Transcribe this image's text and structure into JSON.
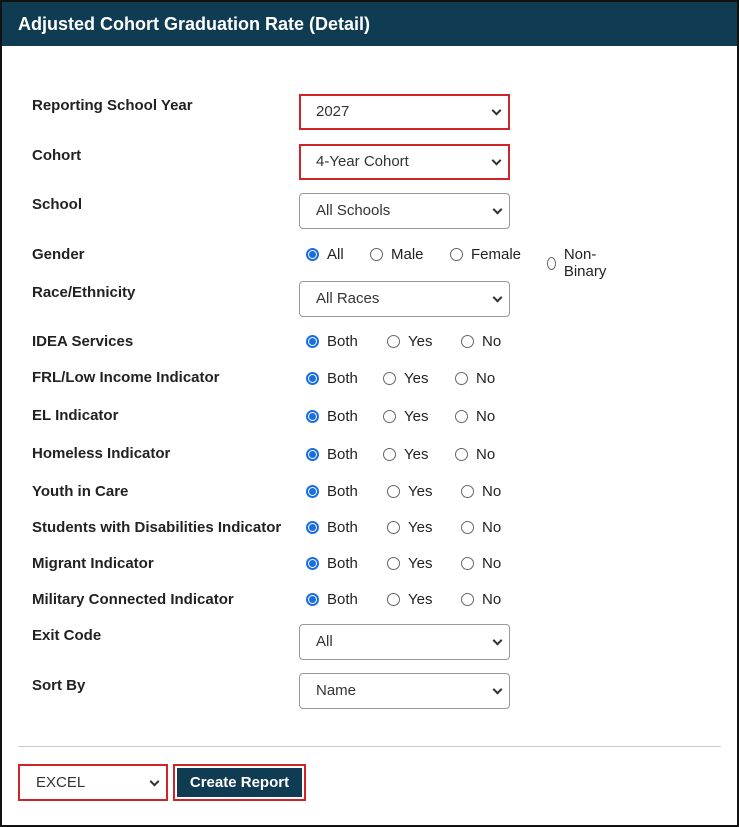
{
  "header": {
    "title": "Adjusted Cohort Graduation Rate (Detail)"
  },
  "fields": {
    "reporting_school_year": {
      "label": "Reporting School Year",
      "value": "2027"
    },
    "cohort": {
      "label": "Cohort",
      "value": "4-Year Cohort"
    },
    "school": {
      "label": "School",
      "value": "All Schools"
    },
    "gender": {
      "label": "Gender",
      "options": [
        "All",
        "Male",
        "Female",
        "Non-Binary"
      ],
      "selected": "All"
    },
    "race_ethnicity": {
      "label": "Race/Ethnicity",
      "value": "All Races"
    },
    "idea_services": {
      "label": "IDEA Services",
      "options": [
        "Both",
        "Yes",
        "No"
      ],
      "selected": "Both"
    },
    "frl": {
      "label": "FRL/Low Income Indicator",
      "options": [
        "Both",
        "Yes",
        "No"
      ],
      "selected": "Both"
    },
    "el": {
      "label": "EL Indicator",
      "options": [
        "Both",
        "Yes",
        "No"
      ],
      "selected": "Both"
    },
    "homeless": {
      "label": "Homeless Indicator",
      "options": [
        "Both",
        "Yes",
        "No"
      ],
      "selected": "Both"
    },
    "youth_in_care": {
      "label": "Youth in Care",
      "options": [
        "Both",
        "Yes",
        "No"
      ],
      "selected": "Both"
    },
    "swd": {
      "label": "Students with Disabilities Indicator",
      "options": [
        "Both",
        "Yes",
        "No"
      ],
      "selected": "Both"
    },
    "migrant": {
      "label": "Migrant Indicator",
      "options": [
        "Both",
        "Yes",
        "No"
      ],
      "selected": "Both"
    },
    "military": {
      "label": "Military Connected Indicator",
      "options": [
        "Both",
        "Yes",
        "No"
      ],
      "selected": "Both"
    },
    "exit_code": {
      "label": "Exit Code",
      "value": "All"
    },
    "sort_by": {
      "label": "Sort By",
      "value": "Name"
    }
  },
  "footer": {
    "format": "EXCEL",
    "create_label": "Create Report"
  },
  "colors": {
    "header_bg": "#0f3b53",
    "highlight_border": "#d0242b",
    "radio_accent": "#1a6fe0"
  }
}
